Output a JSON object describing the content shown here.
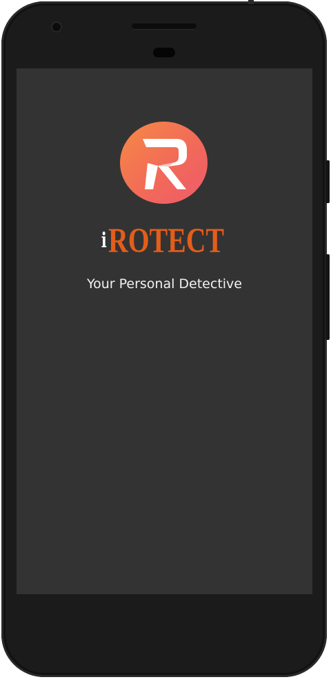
{
  "app": {
    "logo_letter": "R",
    "brand_prefix": "i",
    "brand_name": "ROTECT",
    "tagline": "Your Personal Detective"
  },
  "colors": {
    "screen_background": "#333333",
    "logo_gradient_start": "#f58a45",
    "logo_gradient_end": "#ee5a6c",
    "brand_text": "#e35d1b",
    "tagline_text": "#f2f2f2",
    "device_body": "#1b1b1b"
  },
  "icons": {
    "logo": "r-monogram-icon",
    "brand_mark": "detective-i-icon"
  }
}
